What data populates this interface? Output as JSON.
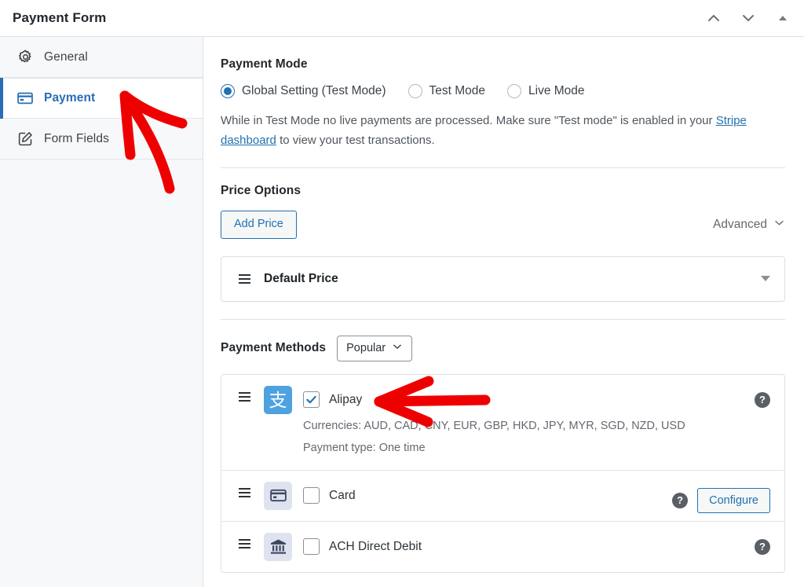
{
  "header": {
    "title": "Payment Form",
    "actions": [
      {
        "name": "move-up-icon",
        "icon": "chevron-up"
      },
      {
        "name": "move-down-icon",
        "icon": "chevron-down"
      },
      {
        "name": "collapse-icon",
        "icon": "triangle-up"
      }
    ]
  },
  "sidebar": {
    "items": [
      {
        "label": "General",
        "icon": "gear-icon",
        "active": false
      },
      {
        "label": "Payment",
        "icon": "credit-card-icon",
        "active": true
      },
      {
        "label": "Form Fields",
        "icon": "pencil-square-icon",
        "active": false
      }
    ]
  },
  "payment_mode": {
    "title": "Payment Mode",
    "options": [
      {
        "label": "Global Setting (Test Mode)",
        "checked": true
      },
      {
        "label": "Test Mode",
        "checked": false
      },
      {
        "label": "Live Mode",
        "checked": false
      }
    ],
    "help_before_link": "While in Test Mode no live payments are processed. Make sure \"Test mode\" is enabled in your ",
    "help_link": "Stripe dashboard",
    "help_after_link": " to view your test transactions."
  },
  "price_options": {
    "title": "Price Options",
    "add_price_label": "Add Price",
    "advanced_label": "Advanced",
    "rows": [
      {
        "label": "Default Price"
      }
    ]
  },
  "payment_methods": {
    "title": "Payment Methods",
    "filter_value": "Popular",
    "methods": [
      {
        "name": "Alipay",
        "checked": true,
        "icon": "alipay-icon",
        "icon_glyph": "支",
        "currencies": "Currencies: AUD, CAD, CNY, EUR, GBP, HKD, JPY, MYR, SGD, NZD, USD",
        "payment_type": "Payment type: One time",
        "has_configure": false,
        "help_label": "?"
      },
      {
        "name": "Card",
        "checked": false,
        "icon": "credit-card-icon",
        "currencies": "",
        "payment_type": "",
        "has_configure": true,
        "configure_label": "Configure",
        "help_label": "?"
      },
      {
        "name": "ACH Direct Debit",
        "checked": false,
        "icon": "bank-icon",
        "currencies": "",
        "payment_type": "",
        "has_configure": false,
        "help_label": "?"
      }
    ]
  },
  "annotations": {
    "color": "#ee0000",
    "arrows": [
      {
        "name": "arrow-pointing-to-payment-tab",
        "target": "Payment"
      },
      {
        "name": "arrow-pointing-to-alipay",
        "target": "Alipay"
      }
    ]
  }
}
